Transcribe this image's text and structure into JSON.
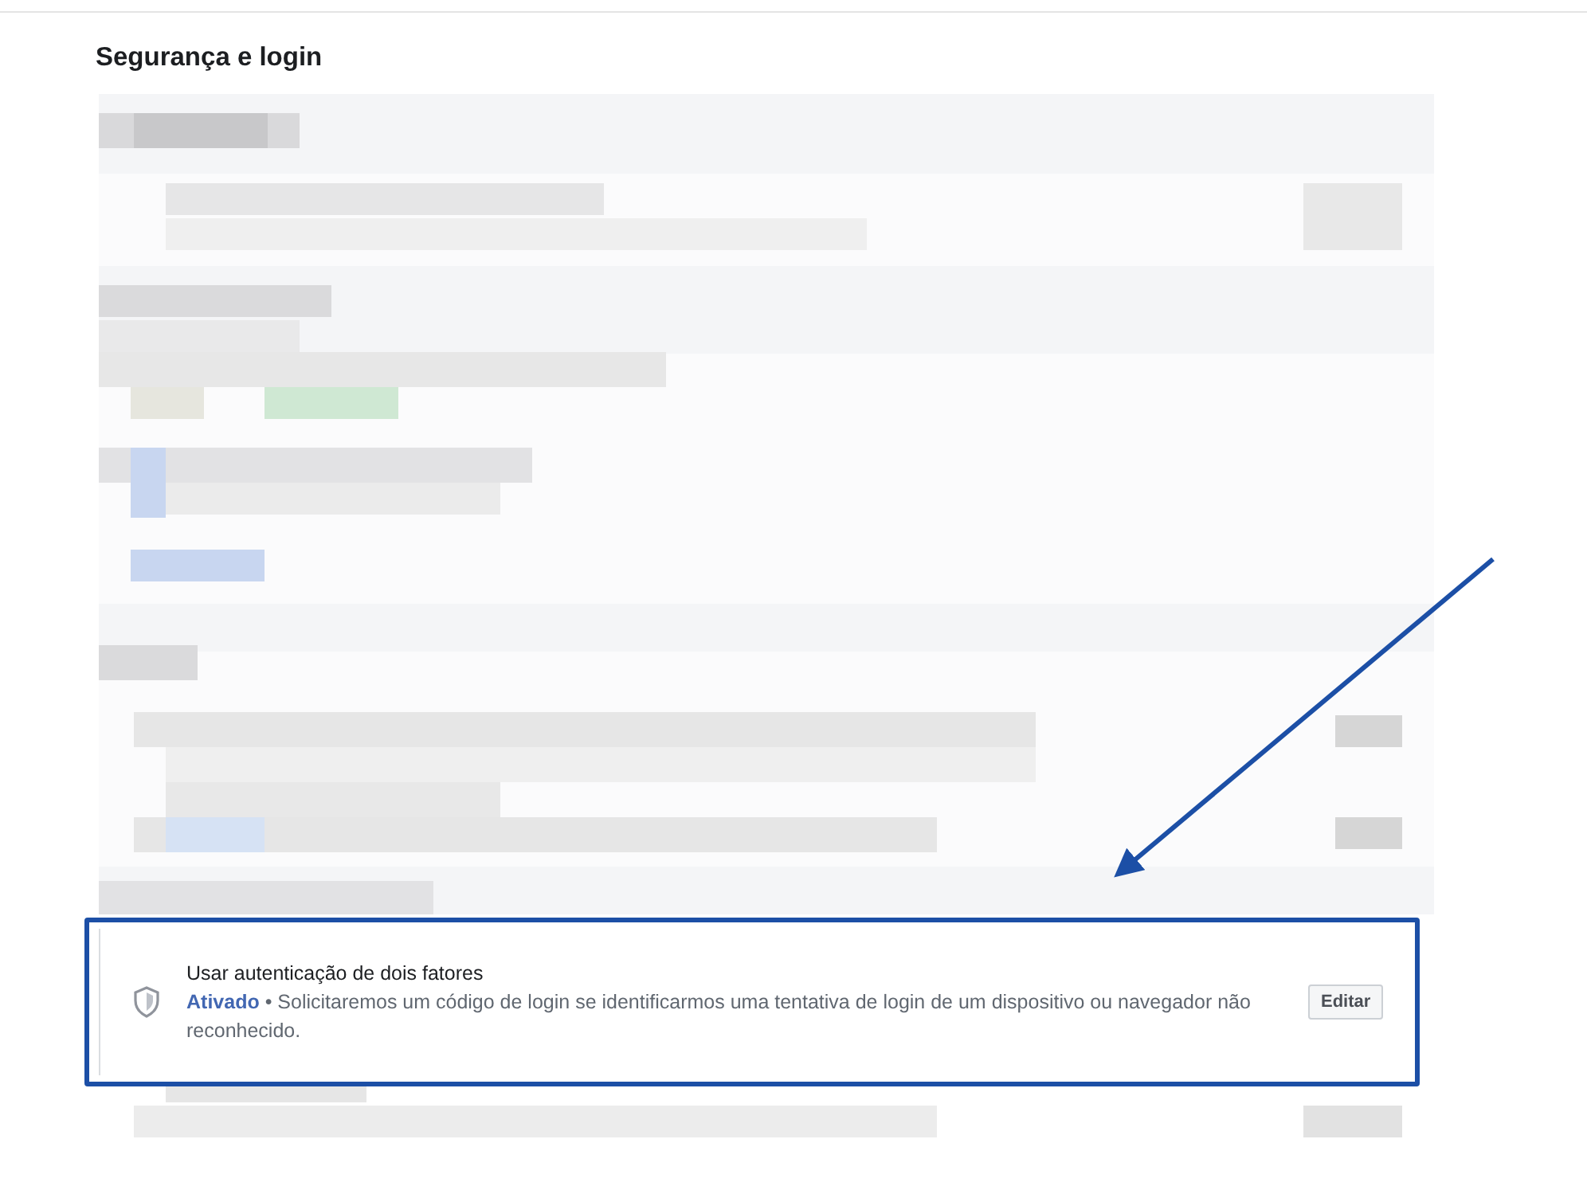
{
  "page_title": "Segurança e login",
  "setting": {
    "title": "Usar autenticação de dois fatores",
    "status": "Ativado",
    "enabled": true,
    "separator": "•",
    "description": "Solicitaremos um código de login se identificarmos uma tentativa de login de um dispositivo ou navegador não reconhecido.",
    "button": "Editar"
  }
}
